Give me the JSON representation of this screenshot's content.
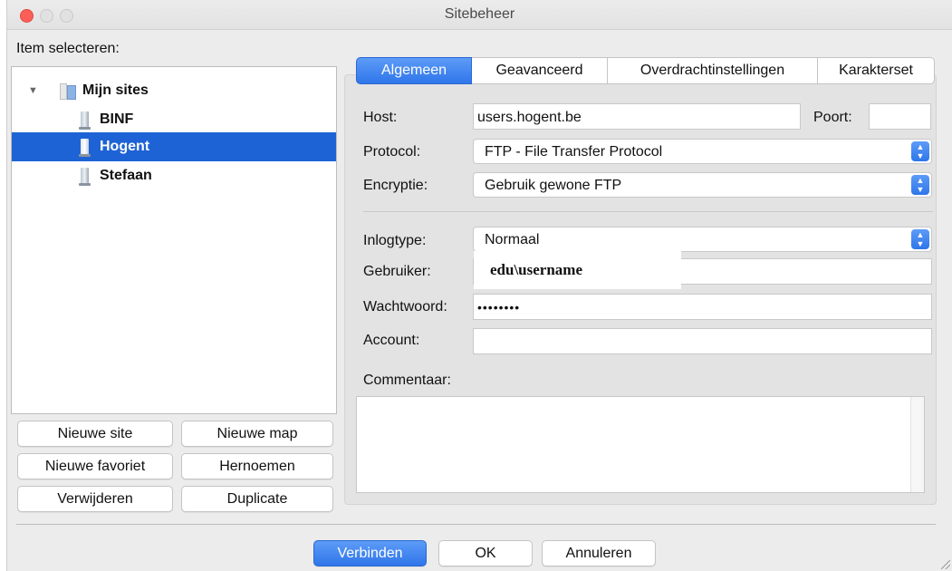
{
  "window": {
    "title": "Sitebeheer"
  },
  "left": {
    "select_label": "Item selecteren:",
    "tree": {
      "root": "Mijn sites",
      "items": [
        "BINF",
        "Hogent",
        "Stefaan"
      ],
      "selected": "Hogent"
    },
    "buttons": {
      "new_site": "Nieuwe site",
      "new_folder": "Nieuwe map",
      "new_bookmark": "Nieuwe favoriet",
      "rename": "Hernoemen",
      "delete": "Verwijderen",
      "duplicate": "Duplicate"
    }
  },
  "tabs": [
    "Algemeen",
    "Geavanceerd",
    "Overdrachtinstellingen",
    "Karakterset"
  ],
  "active_tab": "Algemeen",
  "form": {
    "host_label": "Host:",
    "host_value": "users.hogent.be",
    "port_label": "Poort:",
    "port_value": "",
    "protocol_label": "Protocol:",
    "protocol_value": "FTP - File Transfer Protocol",
    "encryption_label": "Encryptie:",
    "encryption_value": "Gebruik gewone FTP",
    "logontype_label": "Inlogtype:",
    "logontype_value": "Normaal",
    "user_label": "Gebruiker:",
    "user_value": "edu\\username",
    "password_label": "Wachtwoord:",
    "password_value": "••••••••",
    "account_label": "Account:",
    "account_value": "",
    "comments_label": "Commentaar:",
    "comments_value": ""
  },
  "footer": {
    "connect": "Verbinden",
    "ok": "OK",
    "cancel": "Annuleren"
  },
  "colors": {
    "accent": "#2f76ea",
    "selection": "#1e63d5",
    "close": "#fc5f57"
  },
  "icons": {
    "server": "server-icon",
    "folder": "folder-icon",
    "disclosure": "disclosure-triangle-icon",
    "select_arrows": "updown-arrows-icon"
  }
}
